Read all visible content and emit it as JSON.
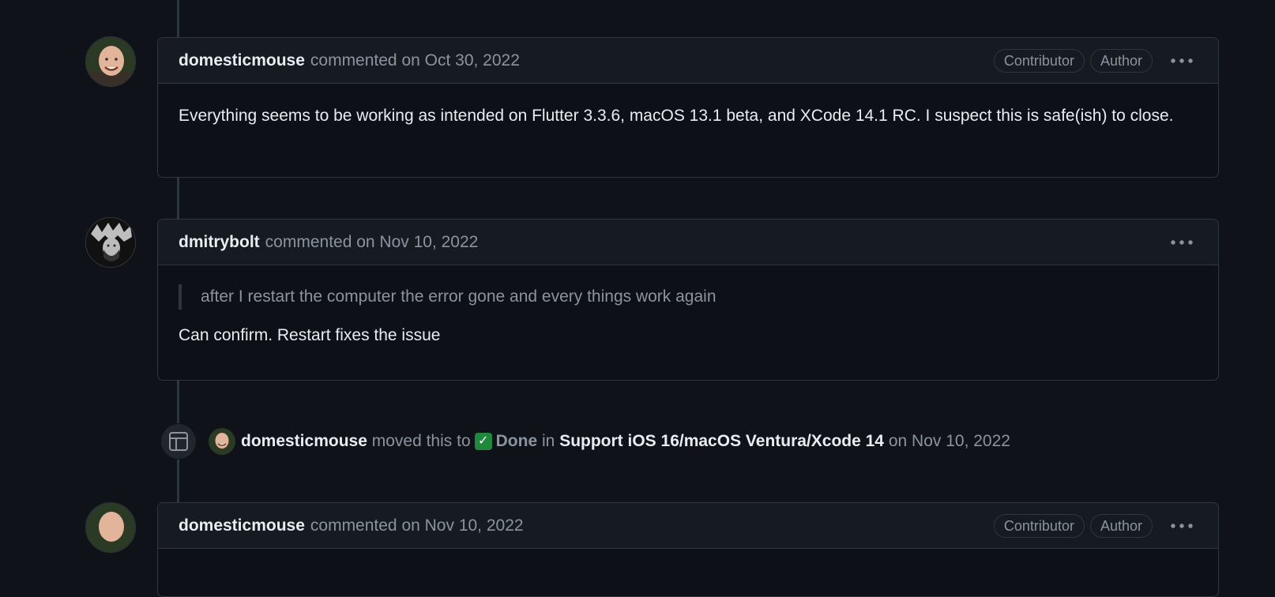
{
  "comments": [
    {
      "author": "domesticmouse",
      "meta": "commented on Oct 30, 2022",
      "labels": [
        "Contributor",
        "Author"
      ],
      "body": "Everything seems to be working as intended on Flutter 3.3.6, macOS 13.1 beta, and XCode 14.1 RC. I suspect this is safe(ish) to close."
    },
    {
      "author": "dmitrybolt",
      "meta": "commented on Nov 10, 2022",
      "quote": "after I restart the computer the error gone and every things work again",
      "body": "Can confirm. Restart fixes the issue"
    },
    {
      "author": "domesticmouse",
      "meta": "commented on Nov 10, 2022",
      "labels": [
        "Contributor",
        "Author"
      ]
    }
  ],
  "event": {
    "actor": "domesticmouse",
    "action": "moved this to",
    "status_icon": "✓",
    "status": "Done",
    "in_word": "in",
    "project": "Support iOS 16/macOS Ventura/Xcode 14",
    "date": "on Nov 10, 2022"
  },
  "icons": {
    "project_table": "table-icon",
    "more": "kebab-horizontal-icon"
  },
  "colors": {
    "background": "#0f1218",
    "border": "#30363d",
    "header_bg": "#161b22",
    "muted_text": "#8b949e",
    "done_green": "#1f883d"
  }
}
